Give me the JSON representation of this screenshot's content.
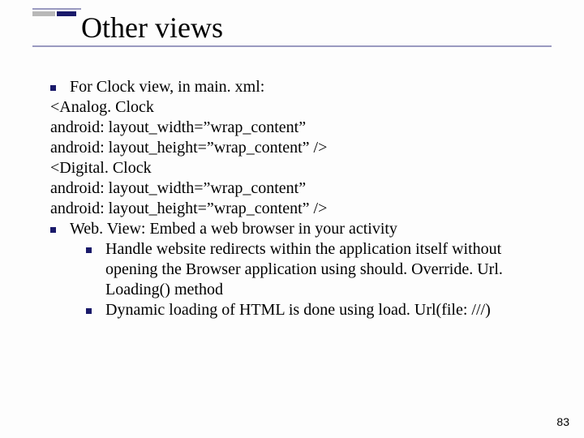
{
  "title": "Other views",
  "body": {
    "0": "For Clock view, in main. xml:",
    "1": "<Analog. Clock",
    "2": "android: layout_width=”wrap_content”",
    "3": "android: layout_height=”wrap_content” />",
    "4": "<Digital. Clock",
    "5": "android: layout_width=”wrap_content”",
    "6": "android: layout_height=”wrap_content” />",
    "7": "Web. View: Embed a web browser in your activity",
    "8": "Handle website redirects within the application itself without opening the Browser application using should. Override. Url. Loading() method",
    "9": "Dynamic loading of HTML is done using load. Url(file: ///)"
  },
  "page_number": "83",
  "colors": {
    "bullet": "#1a1a6a",
    "rule": "#9a9ac0",
    "deco_grey": "#b8b8b8"
  }
}
